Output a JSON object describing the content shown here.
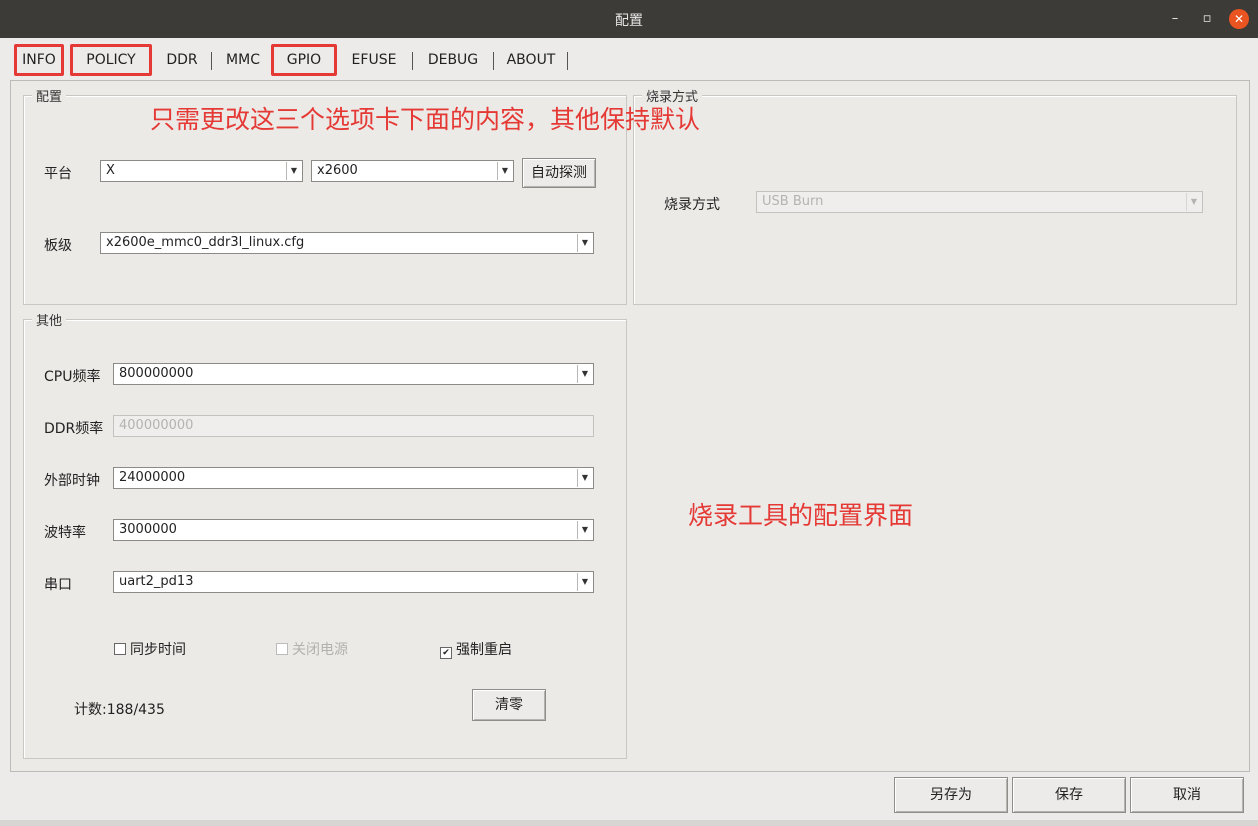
{
  "window": {
    "title": "配置",
    "minimize": "–",
    "maximize": "▫",
    "close": "✕"
  },
  "tabs": [
    {
      "label": "INFO",
      "highlighted": true
    },
    {
      "label": "POLICY",
      "highlighted": true
    },
    {
      "label": "DDR",
      "highlighted": false
    },
    {
      "label": "MMC",
      "highlighted": false
    },
    {
      "label": "GPIO",
      "highlighted": true
    },
    {
      "label": "EFUSE",
      "highlighted": false
    },
    {
      "label": "DEBUG",
      "highlighted": false
    },
    {
      "label": "ABOUT",
      "highlighted": false
    }
  ],
  "config_group": {
    "legend": "配置",
    "platform_label": "平台",
    "platform_value": "X",
    "chip_value": "x2600",
    "auto_detect_button": "自动探测",
    "board_label": "板级",
    "board_value": "x2600e_mmc0_ddr3l_linux.cfg"
  },
  "burn_group": {
    "legend": "烧录方式",
    "mode_label": "烧录方式",
    "mode_value": "USB Burn"
  },
  "other_group": {
    "legend": "其他",
    "cpu_freq_label": "CPU频率",
    "cpu_freq_value": "800000000",
    "ddr_freq_label": "DDR频率",
    "ddr_freq_value": "400000000",
    "ext_clock_label": "外部时钟",
    "ext_clock_value": "24000000",
    "baud_label": "波特率",
    "baud_value": "3000000",
    "serial_label": "串口",
    "serial_value": "uart2_pd13",
    "sync_time_label": "同步时间",
    "sync_time_checked": false,
    "power_off_label": "关闭电源",
    "power_off_checked": false,
    "force_reboot_label": "强制重启",
    "force_reboot_checked": true,
    "count_text": "计数:188/435",
    "clear_button": "清零"
  },
  "annotations": {
    "top_note": "只需更改这三个选项卡下面的内容，其他保持默认",
    "center_note": "烧录工具的配置界面"
  },
  "footer": {
    "save_as_button": "另存为",
    "save_button": "保存",
    "cancel_button": "取消"
  },
  "colors": {
    "annotation_red": "#e53935",
    "titlebar": "#3c3b37",
    "close_button": "#e95420"
  }
}
